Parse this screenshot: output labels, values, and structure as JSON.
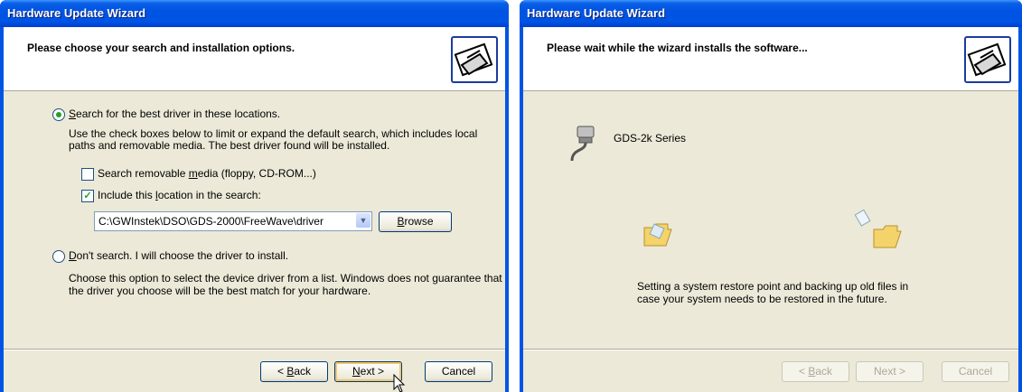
{
  "left": {
    "title": "Hardware Update Wizard",
    "header": "Please choose your search and installation options.",
    "option_search": {
      "pre": "",
      "u": "S",
      "post": "earch for the best driver in these locations."
    },
    "search_desc_1": "Use the check boxes below to limit or expand the default search, which includes local",
    "search_desc_2": "paths and removable media. The best driver found will be installed.",
    "check_removable": {
      "pre": "Search removable ",
      "u": "m",
      "post": "edia (floppy, CD-ROM...)"
    },
    "check_location": {
      "pre": "Include this ",
      "u": "l",
      "post": "ocation in the search:"
    },
    "location_value": "C:\\GWInstek\\DSO\\GDS-2000\\FreeWave\\driver",
    "browse": {
      "pre": "",
      "u": "B",
      "post": "rowse"
    },
    "option_dont": {
      "pre": "",
      "u": "D",
      "post": "on't search. I will choose the driver to install."
    },
    "dont_desc_1": "Choose this option to select the device driver from a list.  Windows does not guarantee that",
    "dont_desc_2": "the driver you choose will be the best match for your hardware.",
    "back": {
      "pre": "< ",
      "u": "B",
      "post": "ack"
    },
    "next": {
      "pre": "",
      "u": "N",
      "post": "ext >"
    },
    "cancel": "Cancel"
  },
  "right": {
    "title": "Hardware Update Wizard",
    "header": "Please wait while the wizard installs the software...",
    "device_name": "GDS-2k Series",
    "status_1": "Setting a system restore point and backing up old files in",
    "status_2": "case your system needs to be restored in the future.",
    "back": {
      "pre": "< ",
      "u": "B",
      "post": "ack"
    },
    "next": "Next >",
    "cancel": "Cancel"
  },
  "colors": {
    "titlebar": "#0054e3",
    "dialog_bg": "#ece9d8",
    "radio_dot": "#21a121"
  },
  "icons": [
    "hardware-wizard-icon",
    "serial-cable-icon",
    "folder-icon",
    "flying-document-icon",
    "mouse-cursor-icon",
    "dropdown-arrow-icon"
  ]
}
